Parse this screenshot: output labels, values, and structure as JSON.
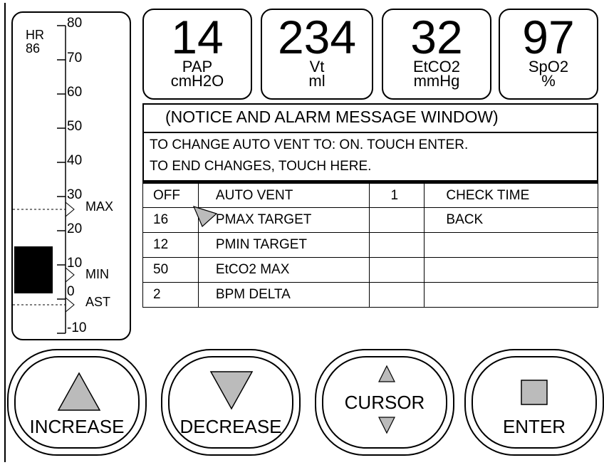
{
  "gauge": {
    "hr_label": "HR",
    "hr_value": "86",
    "scale": [
      "80",
      "70",
      "60",
      "50",
      "40",
      "30",
      "20",
      "10",
      "0",
      "-10"
    ],
    "max_label": "MAX",
    "min_label": "MIN",
    "ast_label": "AST"
  },
  "readouts": [
    {
      "value": "14",
      "name": "PAP",
      "unit": "cmH2O"
    },
    {
      "value": "234",
      "name": "Vt",
      "unit": "ml"
    },
    {
      "value": "32",
      "name": "EtCO2",
      "unit": "mmHg"
    },
    {
      "value": "97",
      "name": "SpO2",
      "unit": "%"
    }
  ],
  "message_window": {
    "title": "(NOTICE AND ALARM MESSAGE WINDOW)",
    "line1": "TO CHANGE AUTO VENT TO:  ON.  TOUCH ENTER.",
    "line2": "TO END CHANGES, TOUCH HERE."
  },
  "settings": [
    {
      "value": "OFF",
      "label": "AUTO VENT",
      "col3": "1",
      "col4": "CHECK TIME"
    },
    {
      "value": "16",
      "label": "PMAX TARGET",
      "col3": "",
      "col4": "BACK"
    },
    {
      "value": "12",
      "label": "PMIN TARGET",
      "col3": "",
      "col4": ""
    },
    {
      "value": "50",
      "label": "EtCO2 MAX",
      "col3": "",
      "col4": ""
    },
    {
      "value": "2",
      "label": "BPM DELTA",
      "col3": "",
      "col4": ""
    }
  ],
  "buttons": {
    "increase": "INCREASE",
    "decrease": "DECREASE",
    "cursor": "CURSOR",
    "enter": "ENTER"
  },
  "icons": [
    "up-triangle-icon",
    "down-triangle-icon",
    "up-down-arrows-icon",
    "square-icon",
    "pointer-arrow-icon"
  ]
}
